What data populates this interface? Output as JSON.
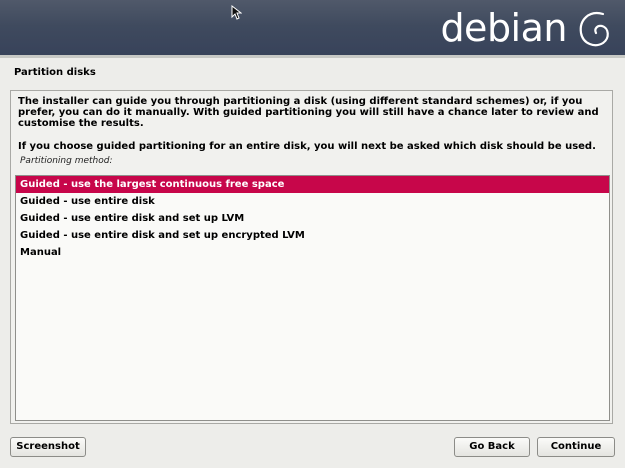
{
  "header": {
    "logo_text": "debian"
  },
  "page": {
    "title": "Partition disks"
  },
  "content": {
    "description": "The installer can guide you through partitioning a disk (using different standard schemes) or, if you prefer, you can do it manually. With guided partitioning you will still have a chance later to review and customise the results.",
    "description2": "If you choose guided partitioning for an entire disk, you will next be asked which disk should be used.",
    "method_label": "Partitioning method:",
    "options": [
      "Guided - use the largest continuous free space",
      "Guided - use entire disk",
      "Guided - use entire disk and set up LVM",
      "Guided - use entire disk and set up encrypted LVM",
      "Manual"
    ],
    "selected_index": 0
  },
  "buttons": {
    "screenshot": "Screenshot",
    "go_back": "Go Back",
    "continue": "Continue"
  },
  "colors": {
    "selection": "#c7064a",
    "header": "#3f4a5e"
  }
}
